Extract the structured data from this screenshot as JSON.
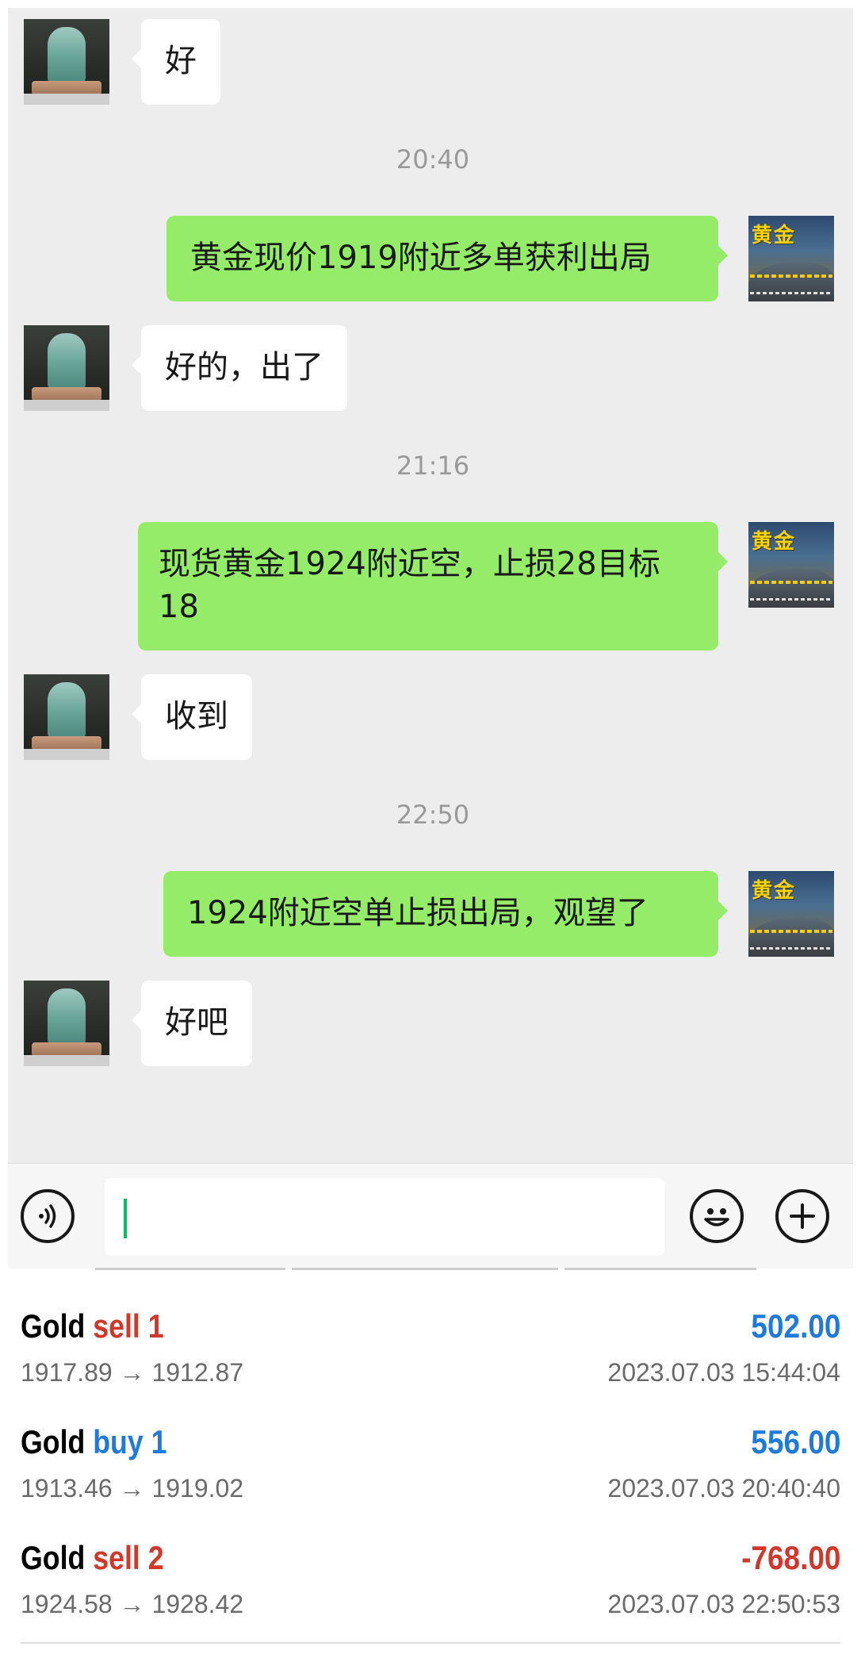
{
  "chat": {
    "messages": [
      {
        "side": "left",
        "text": "好"
      },
      {
        "side": "time",
        "text": "20:40"
      },
      {
        "side": "right",
        "text": "黄金现价1919附近多单获利出局"
      },
      {
        "side": "left",
        "text": "好的，出了"
      },
      {
        "side": "time",
        "text": "21:16"
      },
      {
        "side": "right",
        "text": "现货黄金1924附近空，止损28目标18"
      },
      {
        "side": "left",
        "text": "收到"
      },
      {
        "side": "time",
        "text": "22:50"
      },
      {
        "side": "right",
        "text": "1924附近空单止损出局，观望了"
      },
      {
        "side": "left",
        "text": "好吧"
      }
    ],
    "right_avatar_logo": "黄金",
    "input_value": ""
  },
  "icons": {
    "voice": "voice-icon",
    "emoji": "emoji-icon",
    "plus": "plus-icon"
  },
  "trades": [
    {
      "symbol": "Gold",
      "direction": "sell 1",
      "type": "sell",
      "profit": "502.00",
      "prices": "1917.89 → 1912.87",
      "time": "2023.07.03 15:44:04"
    },
    {
      "symbol": "Gold",
      "direction": "buy 1",
      "type": "buy",
      "profit": "556.00",
      "prices": "1913.46 → 1919.02",
      "time": "2023.07.03 20:40:40"
    },
    {
      "symbol": "Gold",
      "direction": "sell 2",
      "type": "sell",
      "profit": "-768.00",
      "prices": "1924.58 → 1928.42",
      "time": "2023.07.03 22:50:53"
    }
  ],
  "colors": {
    "chat_bg": "#ededed",
    "bubble_self": "#95ec69",
    "bubble_other": "#ffffff",
    "sell": "#d0382b",
    "buy": "#1f7ad9"
  }
}
